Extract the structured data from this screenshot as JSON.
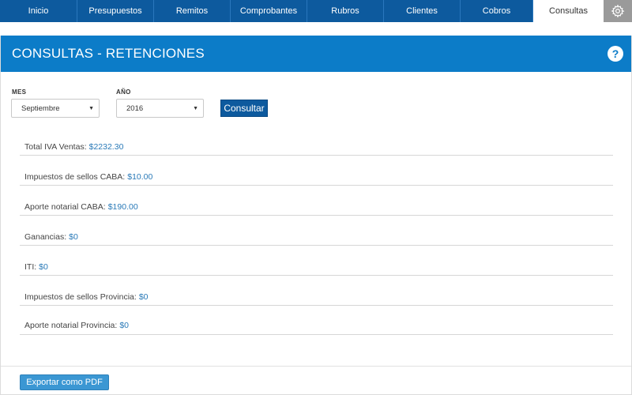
{
  "nav": {
    "tabs": [
      {
        "label": "Inicio"
      },
      {
        "label": "Presupuestos"
      },
      {
        "label": "Remitos"
      },
      {
        "label": "Comprobantes"
      },
      {
        "label": "Rubros"
      },
      {
        "label": "Clientes"
      },
      {
        "label": "Cobros"
      },
      {
        "label": "Consultas",
        "active": true
      }
    ],
    "settings_icon": "gear-icon"
  },
  "header": {
    "title": "CONSULTAS - RETENCIONES",
    "help_icon": "question-mark-icon",
    "help_glyph": "?"
  },
  "filters": {
    "month": {
      "label": "MES",
      "value": "Septiembre"
    },
    "year": {
      "label": "AÑO",
      "value": "2016"
    },
    "submit_label": "Consultar"
  },
  "results": [
    {
      "label": "Total IVA Ventas:",
      "value": "$2232.30"
    },
    {
      "label": "Impuestos de sellos CABA:",
      "value": "$10.00"
    },
    {
      "label": "Aporte notarial CABA:",
      "value": "$190.00"
    },
    {
      "label": "Ganancias:",
      "value": "$0"
    },
    {
      "label": "ITI:",
      "value": "$0"
    },
    {
      "label": "Impuestos de sellos Provincia:",
      "value": "$0"
    },
    {
      "label": "Aporte notarial Provincia:",
      "value": "$0"
    }
  ],
  "footer": {
    "export_label": "Exportar como PDF"
  },
  "colors": {
    "nav": "#0d5a9e",
    "header": "#0c7cc8",
    "value_text": "#2a7ab8",
    "export_button": "#3b97d3"
  }
}
